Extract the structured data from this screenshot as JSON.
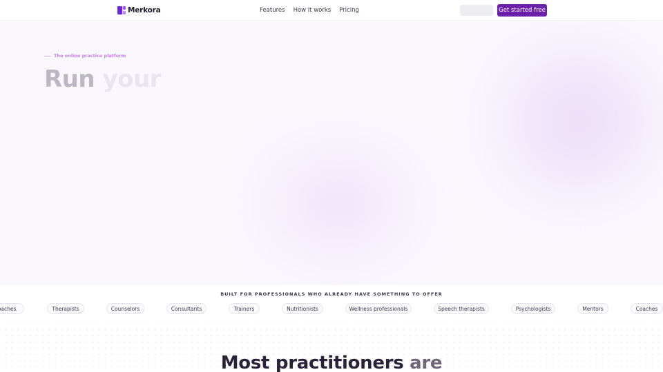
{
  "nav": {
    "brand": "Merkora",
    "links": [
      "Features",
      "How it works",
      "Pricing"
    ],
    "signin_label": "",
    "cta_label": "Get started free"
  },
  "hero": {
    "eyebrow": "The online practice platform",
    "title_word_1": "Run",
    "title_word_2": "your"
  },
  "professions": {
    "label": "BUILT FOR PROFESSIONALS WHO ALREADY HAVE SOMETHING TO OFFER",
    "chips": [
      "Coaches",
      "Therapists",
      "Counselors",
      "Consultants",
      "Trainers",
      "Nutritionists",
      "Wellness professionals",
      "Speech therapists",
      "Psychologists",
      "Mentors",
      "Coaches"
    ]
  },
  "section": {
    "title_part_1": "Most practitioners",
    "title_part_2": "are"
  },
  "colors": {
    "accent": "#6b21a8",
    "eyebrow": "#c57ee6"
  }
}
